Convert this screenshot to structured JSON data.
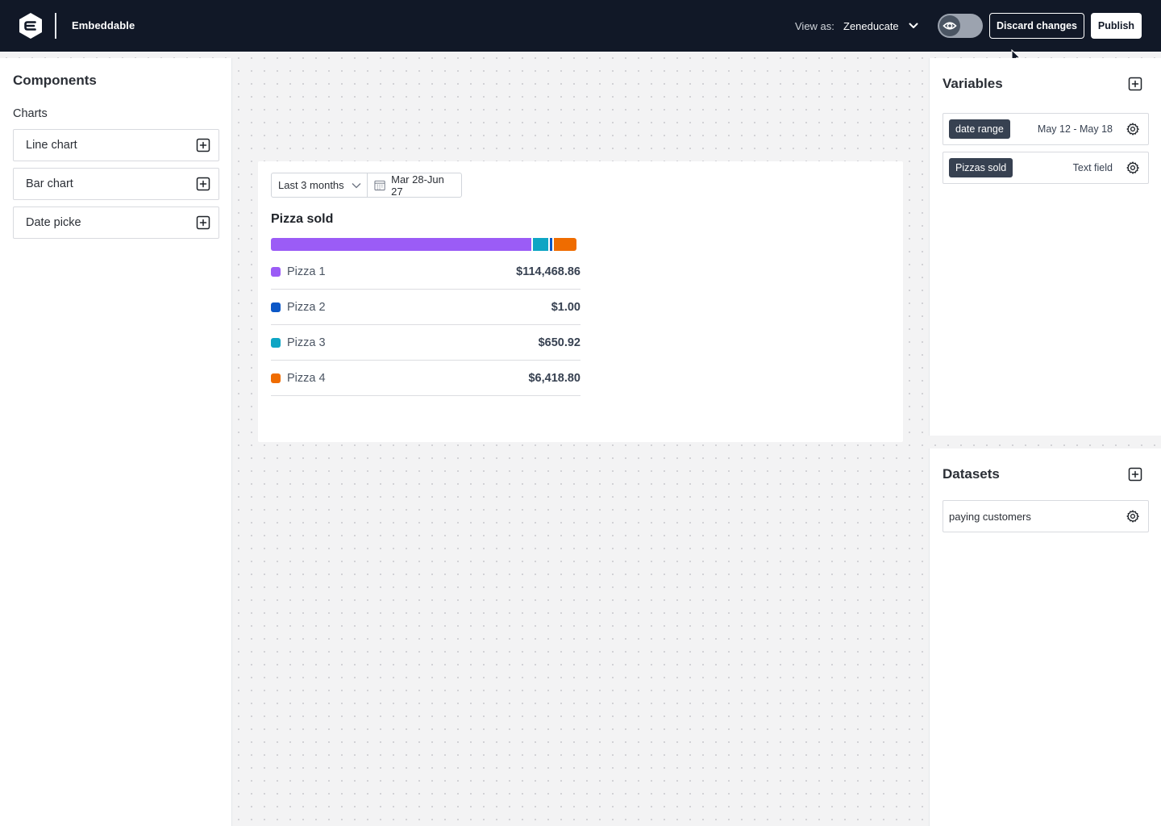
{
  "topbar": {
    "app_name": "Embeddable",
    "view_as_label": "View as:",
    "view_as_value": "Zeneducate",
    "discard_label": "Discard changes",
    "publish_label": "Publish",
    "preview_toggle_on": false
  },
  "components": {
    "title": "Components",
    "section_label": "Charts",
    "items": [
      {
        "label": "Line chart"
      },
      {
        "label": "Bar chart"
      },
      {
        "label": "Date picke"
      }
    ]
  },
  "widget": {
    "range_value": "Last 3 months",
    "date_range": "Mar 28-Jun 27",
    "title": "Pizza sold",
    "rows": [
      {
        "name": "Pizza 1",
        "value": "$114,468.86",
        "color": "#9b5cf6"
      },
      {
        "name": "Pizza 2",
        "value": "$1.00",
        "color": "#0b57c7"
      },
      {
        "name": "Pizza 3",
        "value": "$650.92",
        "color": "#0ea5c4"
      },
      {
        "name": "Pizza 4",
        "value": "$6,418.80",
        "color": "#ef6c00"
      }
    ],
    "bar_fractions": [
      0.855,
      0.05,
      0.008,
      0.075
    ]
  },
  "variables": {
    "title": "Variables",
    "items": [
      {
        "tag": "date range",
        "value": "May 12 - May 18"
      },
      {
        "tag": "Pizzas sold",
        "value": "Text field"
      }
    ]
  },
  "datasets": {
    "title": "Datasets",
    "items": [
      {
        "name": "paying customers"
      }
    ]
  },
  "colors": {
    "topbar_bg": "#111827",
    "tag_bg": "#374151"
  }
}
